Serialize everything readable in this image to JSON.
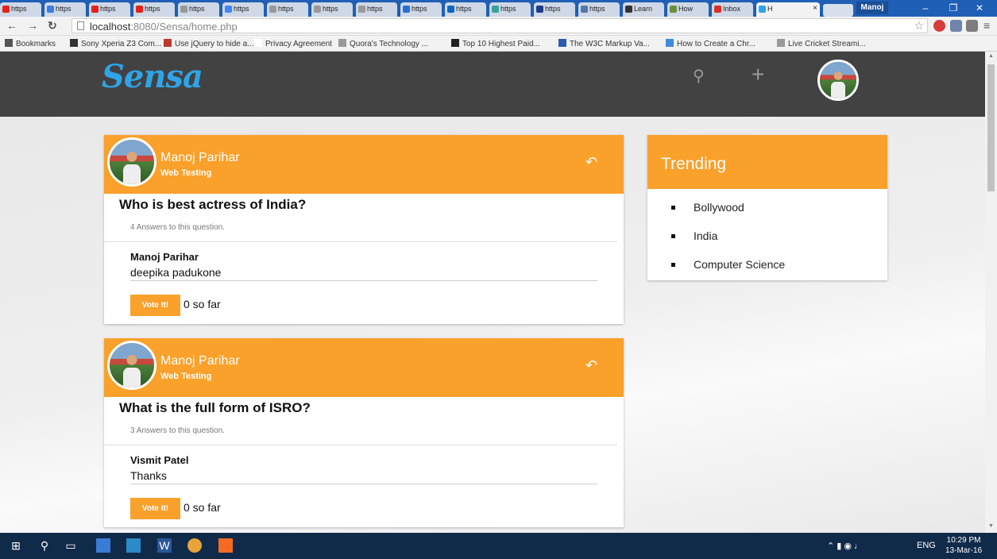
{
  "browser": {
    "tabs": [
      {
        "label": "https",
        "icon": "youtube-icon",
        "color": "#e62117"
      },
      {
        "label": "https",
        "icon": "docs-icon",
        "color": "#3b7de0"
      },
      {
        "label": "https",
        "icon": "youtube-icon",
        "color": "#e62117"
      },
      {
        "label": "https",
        "icon": "youtube-icon",
        "color": "#e62117"
      },
      {
        "label": "https",
        "icon": "page-icon",
        "color": "#999999"
      },
      {
        "label": "https",
        "icon": "google-icon",
        "color": "#4285f4"
      },
      {
        "label": "https",
        "icon": "page-icon",
        "color": "#999999"
      },
      {
        "label": "https",
        "icon": "page-icon",
        "color": "#999999"
      },
      {
        "label": "https",
        "icon": "page-icon",
        "color": "#999999"
      },
      {
        "label": "https",
        "icon": "infinity-icon",
        "color": "#2a6fcf"
      },
      {
        "label": "https",
        "icon": "linkedin-icon",
        "color": "#0a66c2"
      },
      {
        "label": "https",
        "icon": "sh-icon",
        "color": "#3aa0a0"
      },
      {
        "label": "https",
        "icon": "circle-icon",
        "color": "#1e3c8a"
      },
      {
        "label": "https",
        "icon": "feather-icon",
        "color": "#5577aa"
      },
      {
        "label": "Learn",
        "icon": "learn-icon",
        "color": "#333333"
      },
      {
        "label": "How",
        "icon": "wikihow-icon",
        "color": "#6a8f3a"
      },
      {
        "label": "Inbox",
        "icon": "gmail-icon",
        "color": "#d93025"
      },
      {
        "label": "H",
        "icon": "sensa-icon",
        "color": "#2fa4e7",
        "active": true
      }
    ],
    "user": "Manoj",
    "url_host": "localhost",
    "url_rest": ":8080/Sensa/home.php",
    "bookmarks": [
      {
        "label": "Bookmarks",
        "icon": "star-icon"
      },
      {
        "label": "Sony Xperia Z3 Com...",
        "icon": "phone-icon"
      },
      {
        "label": "Use jQuery to hide a...",
        "icon": "cs-icon"
      },
      {
        "label": "Privacy Agreement",
        "icon": "blank-icon"
      },
      {
        "label": "Quora's Technology ...",
        "icon": "page-icon"
      },
      {
        "label": "Top 10 Highest Paid...",
        "icon": "fw-icon"
      },
      {
        "label": "The W3C Markup Va...",
        "icon": "w3-icon"
      },
      {
        "label": "How to Create a Chr...",
        "icon": "code-icon"
      },
      {
        "label": "Live Cricket Streami...",
        "icon": "page-icon"
      }
    ]
  },
  "app": {
    "logo": "Sensa",
    "accent": "#f9a12b",
    "nav_bg": "#424242"
  },
  "posts": [
    {
      "author": "Manoj Parihar",
      "topic": "Web Testing",
      "question": "Who is best actress of India?",
      "answer_count": "4 Answers to this question.",
      "answer_author": "Manoj Parihar",
      "answer_text": "deepika padukone",
      "vote_label": "Vote It!",
      "vote_count": "0 so far"
    },
    {
      "author": "Manoj Parihar",
      "topic": "Web Testing",
      "question": "What is the full form of ISRO?",
      "answer_count": "3 Answers to this question.",
      "answer_author": "Vismit Patel",
      "answer_text": "Thanks",
      "vote_label": "Vote It!",
      "vote_count": "0 so far"
    }
  ],
  "trending": {
    "title": "Trending",
    "items": [
      "Bollywood",
      "India",
      "Computer Science"
    ]
  },
  "taskbar": {
    "lang": "ENG",
    "time": "10:29 PM",
    "date": "13-Mar-16"
  }
}
